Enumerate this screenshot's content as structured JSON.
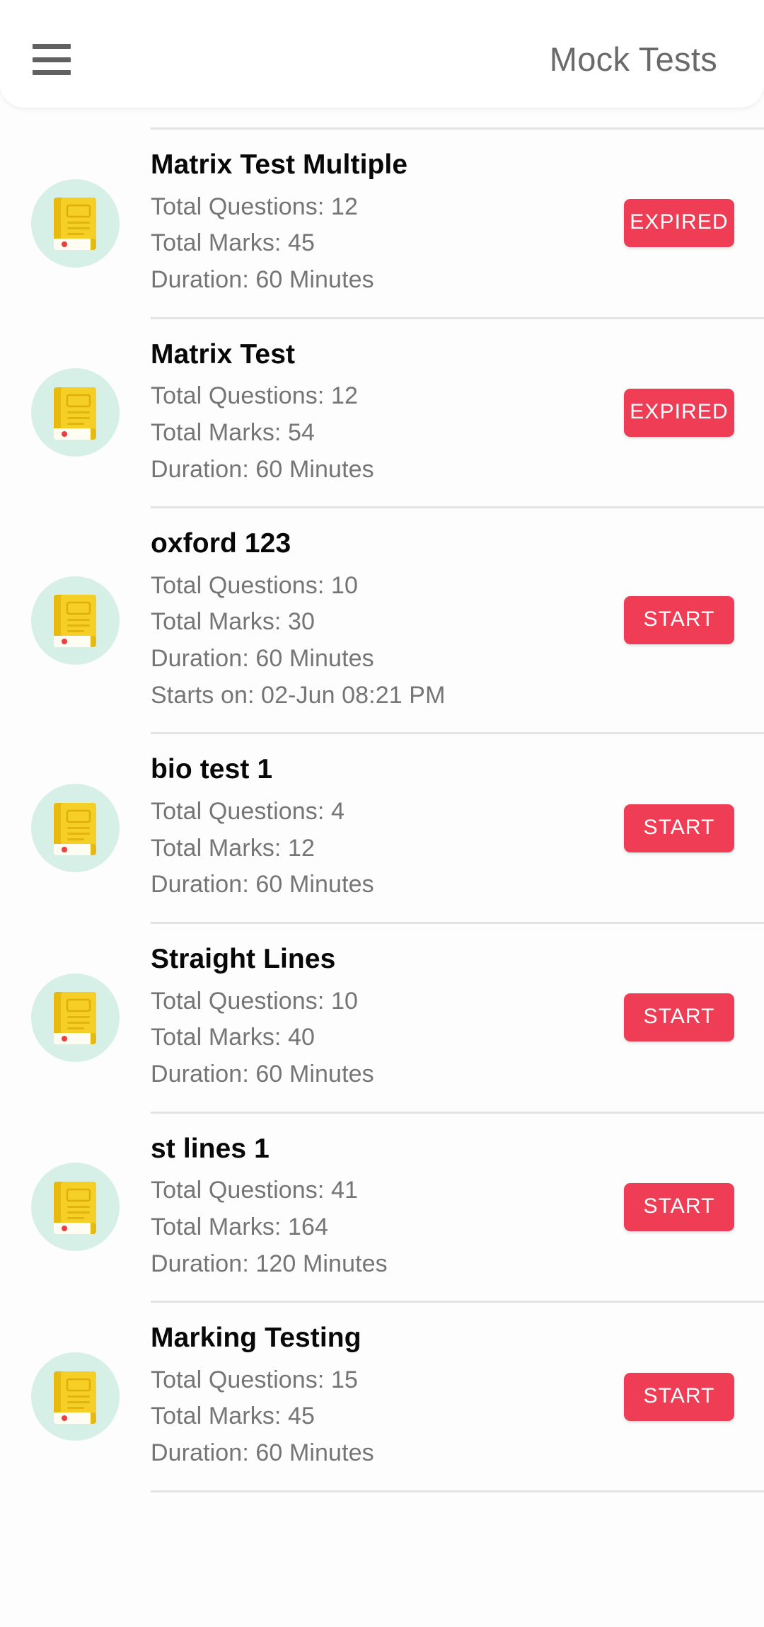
{
  "header": {
    "title": "Mock Tests",
    "menu_icon": "hamburger-menu-icon"
  },
  "theme": {
    "accent_red": "#ef3d55",
    "icon_circle_bg": "#d6f0e7",
    "book_yellow": "#f2c617",
    "title_color": "#080808",
    "meta_color": "#757575",
    "appbar_title_color": "#6a6a6a",
    "divider_color": "#e3e3e3"
  },
  "labels": {
    "questions_prefix": "Total Questions: ",
    "marks_prefix": "Total Marks: ",
    "duration_prefix": "Duration: ",
    "starts_prefix": "Starts on: ",
    "expired": "EXPIRED",
    "start": "START"
  },
  "tests": [
    {
      "name": "Matrix Test Multiple",
      "questions": "Total Questions: 12",
      "marks": "Total Marks: 45",
      "duration": "Duration: 60 Minutes",
      "starts_on": "",
      "action": "EXPIRED",
      "action_type": "expired",
      "icon": "book-icon"
    },
    {
      "name": "Matrix Test",
      "questions": "Total Questions: 12",
      "marks": "Total Marks: 54",
      "duration": "Duration: 60 Minutes",
      "starts_on": "",
      "action": "EXPIRED",
      "action_type": "expired",
      "icon": "book-icon"
    },
    {
      "name": "oxford 123",
      "questions": "Total Questions: 10",
      "marks": "Total Marks: 30",
      "duration": "Duration: 60 Minutes",
      "starts_on": "Starts on: 02-Jun 08:21 PM",
      "action": "START",
      "action_type": "start",
      "icon": "book-icon"
    },
    {
      "name": "bio test 1",
      "questions": "Total Questions: 4",
      "marks": "Total Marks: 12",
      "duration": "Duration: 60 Minutes",
      "starts_on": "",
      "action": "START",
      "action_type": "start",
      "icon": "book-icon"
    },
    {
      "name": "Straight Lines",
      "questions": "Total Questions: 10",
      "marks": "Total Marks: 40",
      "duration": "Duration: 60 Minutes",
      "starts_on": "",
      "action": "START",
      "action_type": "start",
      "icon": "book-icon"
    },
    {
      "name": "st lines 1",
      "questions": "Total Questions: 41",
      "marks": "Total Marks: 164",
      "duration": "Duration: 120 Minutes",
      "starts_on": "",
      "action": "START",
      "action_type": "start",
      "icon": "book-icon"
    },
    {
      "name": "Marking Testing",
      "questions": "Total Questions: 15",
      "marks": "Total Marks: 45",
      "duration": "Duration: 60 Minutes",
      "starts_on": "",
      "action": "START",
      "action_type": "start",
      "icon": "book-icon"
    }
  ]
}
